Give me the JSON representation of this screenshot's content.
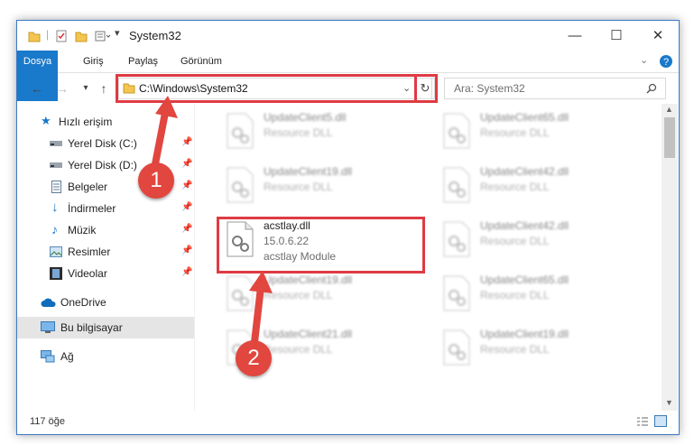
{
  "window": {
    "title": "System32"
  },
  "controls": {
    "minimize": "—",
    "maximize": "☐",
    "close": "✕"
  },
  "ribbon": {
    "file": "Dosya",
    "tabs": [
      "Giriş",
      "Paylaş",
      "Görünüm"
    ]
  },
  "address": {
    "path": "C:\\Windows\\System32",
    "search_placeholder": "Ara: System32"
  },
  "nav": {
    "quick_access": "Hızlı erişim",
    "items": [
      "Yerel Disk (C:)",
      "Yerel Disk (D:)",
      "Belgeler",
      "İndirmeler",
      "Müzik",
      "Resimler",
      "Videolar"
    ],
    "onedrive": "OneDrive",
    "this_pc": "Bu bilgisayar",
    "network": "Ağ"
  },
  "files": [
    {
      "name": "UpdateClient5.dll",
      "desc": "Resource DLL"
    },
    {
      "name": "UpdateClient65.dll",
      "desc": "Resource DLL"
    },
    {
      "name": "UpdateClient19.dll",
      "desc": "Resource DLL"
    },
    {
      "name": "UpdateClient42.dll",
      "desc": "Resource DLL"
    },
    {
      "name": "acstlay.dll",
      "version": "15.0.6.22",
      "desc": "acstlay Module"
    },
    {
      "name": "UpdateClient42.dll",
      "desc": "Resource DLL"
    },
    {
      "name": "UpdateClient19.dll",
      "desc": "Resource DLL"
    },
    {
      "name": "UpdateClient65.dll",
      "desc": "Resource DLL"
    },
    {
      "name": "UpdateClient21.dll",
      "desc": "Resource DLL"
    },
    {
      "name": "UpdateClient19.dll",
      "desc": "Resource DLL"
    }
  ],
  "status": {
    "count": "117 öğe"
  },
  "annotations": {
    "step1": "1",
    "step2": "2"
  },
  "colors": {
    "accent": "#1979ca",
    "highlight": "#de3b43"
  }
}
